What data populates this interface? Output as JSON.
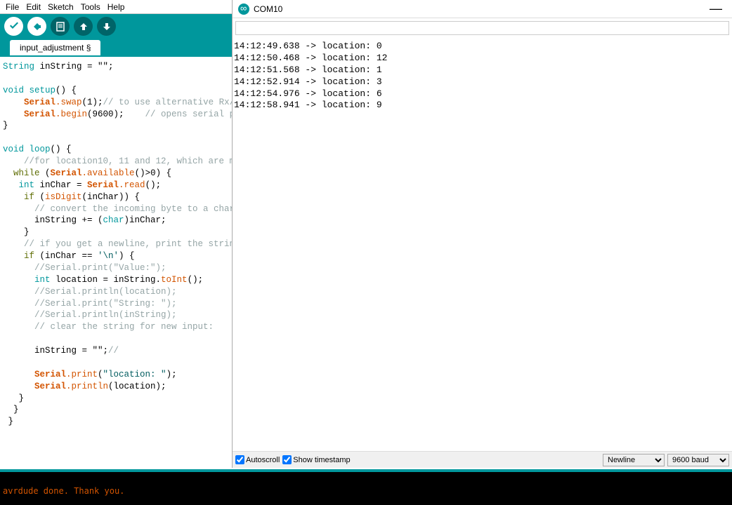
{
  "menu": {
    "file": "File",
    "edit": "Edit",
    "sketch": "Sketch",
    "tools": "Tools",
    "help": "Help"
  },
  "tab": {
    "name": "input_adjustment §"
  },
  "code": {
    "l1_type": "String",
    "l1_rest": " inString = \"\";",
    "l3_void": "void",
    "l3_setup": " setup",
    "l3_rest": "() {",
    "l4_serial": "    Serial",
    "l4_swap": ".swap",
    "l4_args": "(1);",
    "l4_comment": "// to use alternative Rx/",
    "l5_serial": "    Serial",
    "l5_begin": ".begin",
    "l5_args": "(9600);    ",
    "l5_comment": "// opens serial p",
    "l6": "}",
    "l8_void": "void",
    "l8_loop": " loop",
    "l8_rest": "() {",
    "l9_comment": "    //for location10, 11 and 12, which are m",
    "l10_while": "  while",
    "l10_a": " (",
    "l10_serial": "Serial",
    "l10_av": ".available",
    "l10_rest": "()>0) {",
    "l11_int": "   int",
    "l11_a": " inChar = ",
    "l11_serial": "Serial",
    "l11_read": ".read",
    "l11_rest": "();",
    "l12_if": "    if",
    "l12_a": " (",
    "l12_isdigit": "isDigit",
    "l12_rest": "(inChar)) {",
    "l13_comment": "      // convert the incoming byte to a char",
    "l14_a": "      inString += (",
    "l14_char": "char",
    "l14_rest": ")inChar;",
    "l15": "    }",
    "l16_comment": "    // if you get a newline, print the strin",
    "l17_if": "    if",
    "l17_a": " (inChar == ",
    "l17_nl": "'\\n'",
    "l17_rest": ") {",
    "l18_comment": "      //Serial.print(\"Value:\");",
    "l19_int": "      int",
    "l19_a": " location = inString.",
    "l19_toint": "toInt",
    "l19_rest": "();",
    "l20_comment": "      //Serial.println(location);",
    "l21_comment": "      //Serial.print(\"String: \");",
    "l22_comment": "      //Serial.println(inString);",
    "l23_comment": "      // clear the string for new input:",
    "l25_a": "      inString = \"\";",
    "l25_comment": "//",
    "l27_serial": "      Serial",
    "l27_print": ".print",
    "l27_a": "(",
    "l27_str": "\"location: \"",
    "l27_rest": ");",
    "l28_serial": "      Serial",
    "l28_println": ".println",
    "l28_rest": "(location);",
    "l29": "   }",
    "l30": "  }",
    "l31": " }"
  },
  "console_text": "avrdude done.  Thank you.",
  "serial": {
    "title": "COM10",
    "lines": [
      "14:12:49.638 -> location: 0",
      "14:12:50.468 -> location: 12",
      "14:12:51.568 -> location: 1",
      "14:12:52.914 -> location: 3",
      "14:12:54.976 -> location: 6",
      "14:12:58.941 -> location: 9"
    ],
    "autoscroll": "Autoscroll",
    "show_timestamp": "Show timestamp",
    "line_ending": "Newline",
    "baud": "9600 baud"
  }
}
